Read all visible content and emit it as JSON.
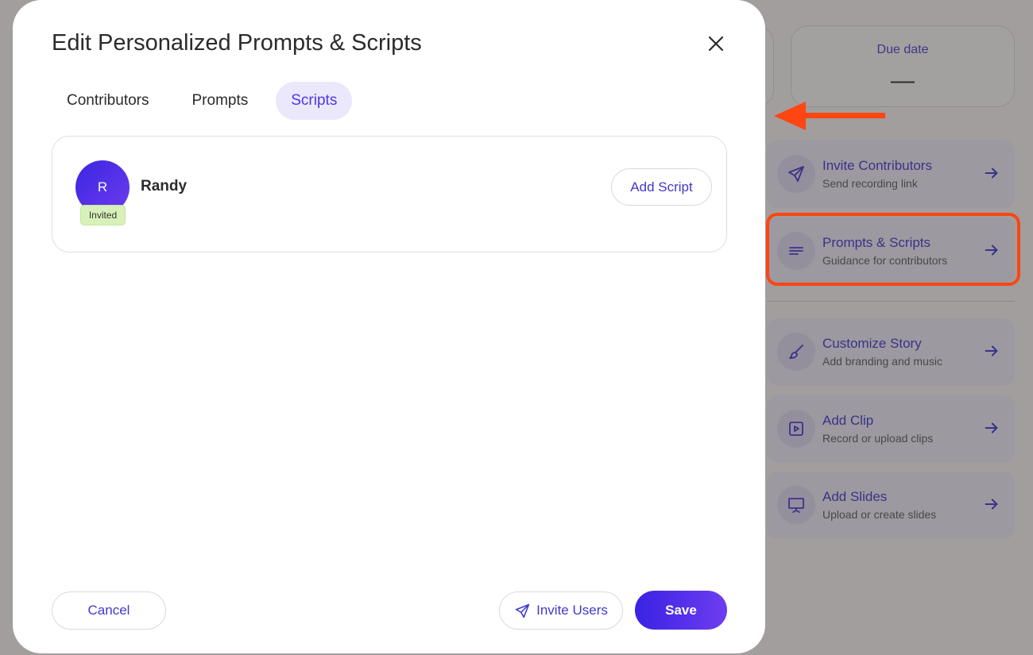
{
  "background": {
    "due_card": {
      "label": "Due date",
      "value": "—"
    },
    "actions": [
      {
        "title": "Invite Contributors",
        "subtitle": "Send recording link",
        "icon": "send-icon"
      },
      {
        "title": "Prompts & Scripts",
        "subtitle": "Guidance for contributors",
        "icon": "lines-icon"
      },
      {
        "title": "Customize Story",
        "subtitle": "Add branding and music",
        "icon": "brush-icon"
      },
      {
        "title": "Add Clip",
        "subtitle": "Record or upload clips",
        "icon": "play-square-icon"
      },
      {
        "title": "Add Slides",
        "subtitle": "Upload or create slides",
        "icon": "presentation-icon"
      }
    ]
  },
  "modal": {
    "title": "Edit Personalized Prompts & Scripts",
    "tabs": [
      {
        "label": "Contributors",
        "active": false
      },
      {
        "label": "Prompts",
        "active": false
      },
      {
        "label": "Scripts",
        "active": true
      }
    ],
    "contributor": {
      "initial": "R",
      "name": "Randy",
      "status": "Invited",
      "action_label": "Add Script"
    },
    "footer": {
      "cancel_label": "Cancel",
      "invite_label": "Invite Users",
      "save_label": "Save"
    }
  },
  "colors": {
    "accent": "#4338ca",
    "annotation": "#ff4512",
    "badge_bg": "#d8f0b9"
  }
}
